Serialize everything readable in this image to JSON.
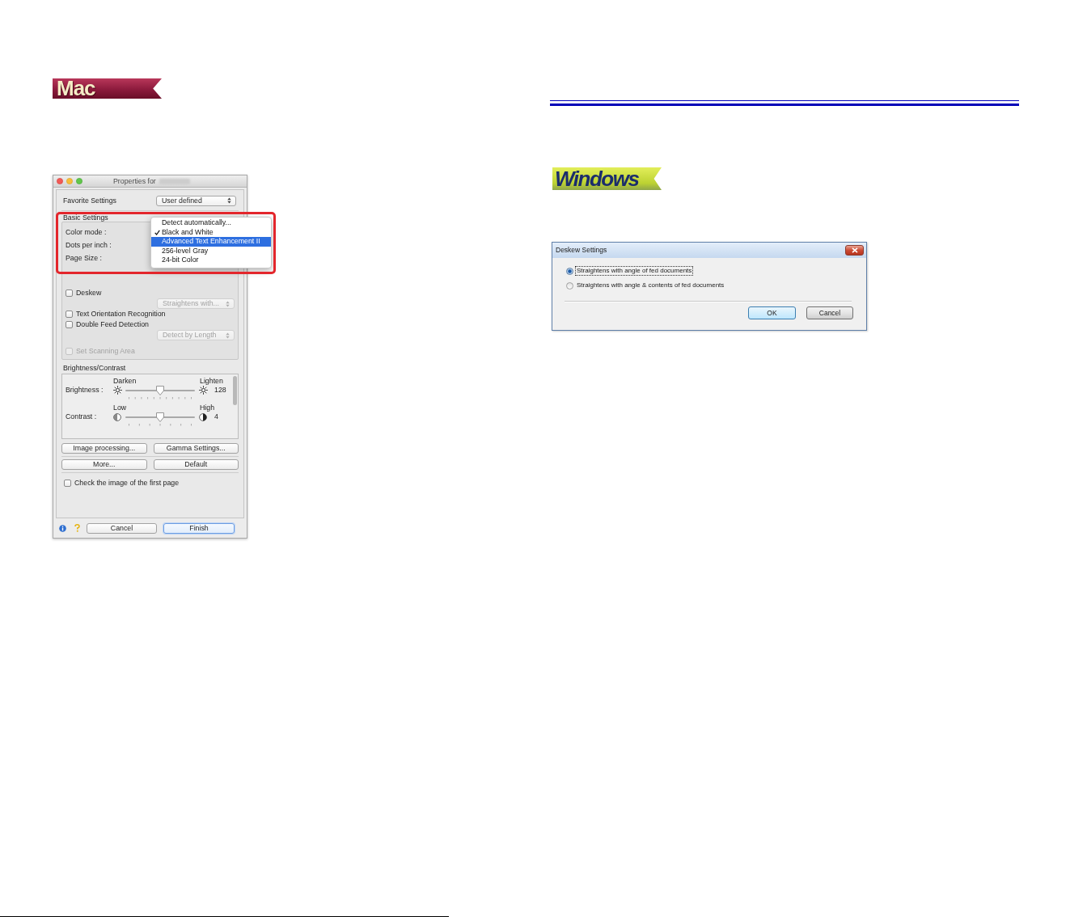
{
  "mac_section": {
    "banner": "Mac",
    "dialog": {
      "title": "Properties for",
      "favorite_settings": {
        "label": "Favorite Settings",
        "value": "User defined"
      },
      "basic_settings": {
        "title": "Basic Settings",
        "rows": [
          {
            "label": "Color mode :"
          },
          {
            "label": "Dots per inch :"
          },
          {
            "label": "Page Size :"
          }
        ],
        "menu": [
          {
            "label": "Detect automatically...",
            "checked": false,
            "selected": false
          },
          {
            "label": "Black and White",
            "checked": true,
            "selected": false
          },
          {
            "label": "Advanced Text Enhancement II",
            "checked": false,
            "selected": true
          },
          {
            "label": "256-level Gray",
            "checked": false,
            "selected": false
          },
          {
            "label": "24-bit Color",
            "checked": false,
            "selected": false
          }
        ],
        "options": [
          {
            "kind": "checkbox",
            "label": "Deskew",
            "checked": false,
            "disabled": false
          },
          {
            "kind": "popup",
            "value": "Straightens with...",
            "disabled": true
          },
          {
            "kind": "checkbox",
            "label": "Text Orientation Recognition",
            "checked": false,
            "disabled": false
          },
          {
            "kind": "checkbox",
            "label": "Double Feed Detection",
            "checked": false,
            "disabled": false
          },
          {
            "kind": "popup",
            "value": "Detect by Length",
            "disabled": true
          },
          {
            "kind": "checkbox",
            "label": "Set Scanning Area",
            "checked": false,
            "disabled": true
          }
        ]
      },
      "brightness_contrast": {
        "title": "Brightness/Contrast",
        "sliders": [
          {
            "kind": "brightness",
            "label": "Brightness :",
            "min_label": "Darken",
            "max_label": "Lighten",
            "level": 0.5,
            "reading": "128"
          },
          {
            "kind": "contrast",
            "label": "Contrast :",
            "min_label": "Low",
            "max_label": "High",
            "level": 0.5,
            "reading": "4"
          }
        ]
      },
      "button_rows": [
        [
          {
            "label": "Image processing..."
          },
          {
            "label": "Gamma Settings..."
          }
        ],
        [
          {
            "label": "More..."
          },
          {
            "label": "Default"
          }
        ]
      ],
      "first_page_check": {
        "label": "Check the image of the first page",
        "checked": false
      },
      "footer_buttons": [
        {
          "label": "Cancel",
          "default": false
        },
        {
          "label": "Finish",
          "default": true
        }
      ]
    }
  },
  "windows_section": {
    "banner": "Windows",
    "dialog": {
      "title": "Deskew Settings",
      "options": [
        {
          "label": "Straightens with angle of fed documents",
          "selected": true,
          "focused": true
        },
        {
          "label": "Straightens with angle & contents of fed documents",
          "selected": false,
          "focused": false
        }
      ],
      "buttons": [
        {
          "label": "OK",
          "default": true
        },
        {
          "label": "Cancel",
          "default": false
        }
      ]
    }
  }
}
